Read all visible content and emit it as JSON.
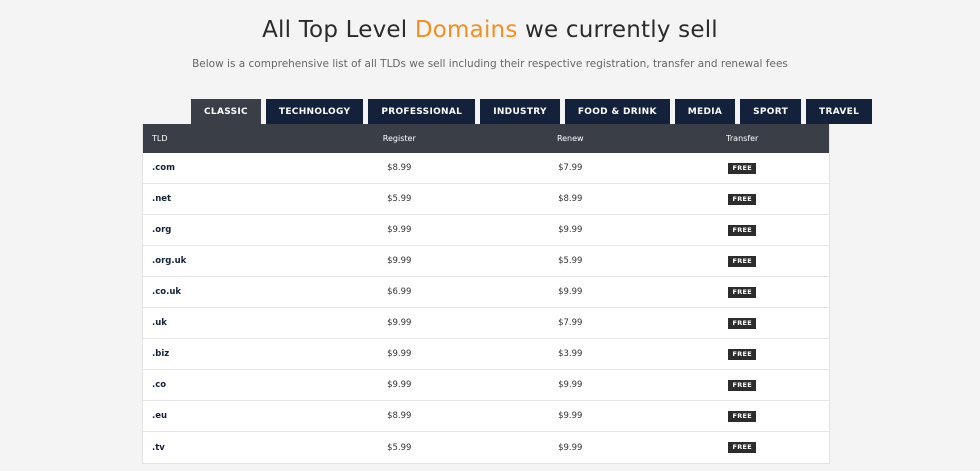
{
  "header": {
    "title_prefix": "All Top Level ",
    "title_accent": "Domains",
    "title_suffix": " we currently sell",
    "subtitle": "Below is a comprehensive list of all TLDs we sell including their respective registration, transfer and renewal fees"
  },
  "tabs": [
    {
      "label": "CLASSIC",
      "active": true
    },
    {
      "label": "TECHNOLOGY",
      "active": false
    },
    {
      "label": "PROFESSIONAL",
      "active": false
    },
    {
      "label": "INDUSTRY",
      "active": false
    },
    {
      "label": "FOOD & DRINK",
      "active": false
    },
    {
      "label": "MEDIA",
      "active": false
    },
    {
      "label": "SPORT",
      "active": false
    },
    {
      "label": "TRAVEL",
      "active": false
    }
  ],
  "table": {
    "columns": [
      "TLD",
      "Register",
      "Renew",
      "Transfer"
    ],
    "rows": [
      {
        "tld": ".com",
        "register": "$8.99",
        "renew": "$7.99",
        "transfer": "FREE"
      },
      {
        "tld": ".net",
        "register": "$5.99",
        "renew": "$8.99",
        "transfer": "FREE"
      },
      {
        "tld": ".org",
        "register": "$9.99",
        "renew": "$9.99",
        "transfer": "FREE"
      },
      {
        "tld": ".org.uk",
        "register": "$9.99",
        "renew": "$5.99",
        "transfer": "FREE"
      },
      {
        "tld": ".co.uk",
        "register": "$6.99",
        "renew": "$9.99",
        "transfer": "FREE"
      },
      {
        "tld": ".uk",
        "register": "$9.99",
        "renew": "$7.99",
        "transfer": "FREE"
      },
      {
        "tld": ".biz",
        "register": "$9.99",
        "renew": "$3.99",
        "transfer": "FREE"
      },
      {
        "tld": ".co",
        "register": "$9.99",
        "renew": "$9.99",
        "transfer": "FREE"
      },
      {
        "tld": ".eu",
        "register": "$8.99",
        "renew": "$9.99",
        "transfer": "FREE"
      },
      {
        "tld": ".tv",
        "register": "$5.99",
        "renew": "$9.99",
        "transfer": "FREE"
      }
    ]
  },
  "colors": {
    "accent": "#f0901e",
    "tab_bg": "#13213a",
    "tab_active_bg": "#3a3f47",
    "table_header_bg": "#3a3f47",
    "badge_bg": "#2c2c2c"
  }
}
